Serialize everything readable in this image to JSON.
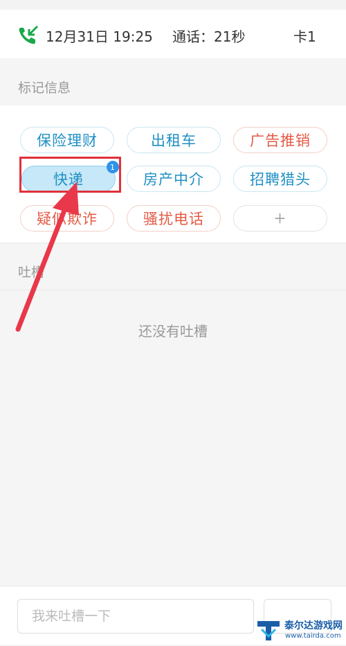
{
  "call": {
    "icon": "incoming-call-icon",
    "icon_color": "#1aa84b",
    "datetime": "12月31日 19:25",
    "duration": "通话：21秒",
    "sim": "卡1"
  },
  "mark_section": {
    "title": "标记信息"
  },
  "tags": [
    {
      "label": "保险理财",
      "color": "#1f8fc4"
    },
    {
      "label": "出租车",
      "color": "#1f8fc4"
    },
    {
      "label": "广告推销",
      "color": "#e35b45"
    },
    {
      "label": "快递",
      "color": "#1f8fc4",
      "selected": true,
      "badge": "1"
    },
    {
      "label": "房产中介",
      "color": "#1f8fc4"
    },
    {
      "label": "招聘猎头",
      "color": "#1f8fc4"
    },
    {
      "label": "疑似欺诈",
      "color": "#e35b45"
    },
    {
      "label": "骚扰电话",
      "color": "#e35b45"
    },
    {
      "label": "+",
      "color": "#aaaaaa"
    }
  ],
  "comments": {
    "title": "吐槽",
    "empty_text": "还没有吐槽"
  },
  "composer": {
    "placeholder": "我来吐槽一下"
  },
  "annotation": {
    "highlight_color": "#e0303a",
    "arrow_color": "#e8384a"
  },
  "watermark": {
    "name": "泰尔达游戏网",
    "url": "www.tairda.com"
  }
}
